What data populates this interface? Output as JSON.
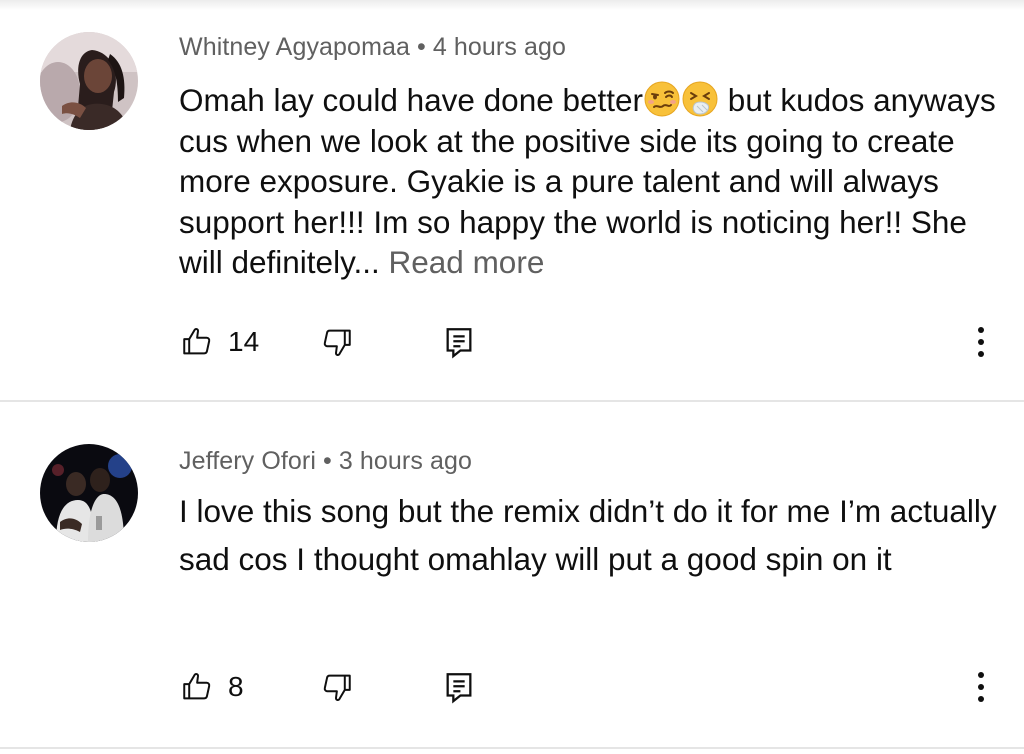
{
  "comments": [
    {
      "author": "Whitney Agyapomaa",
      "separator": "•",
      "time": "4 hours ago",
      "text_before_emoji": "Omah lay could have done better",
      "emojis": [
        "woozy-face-emoji",
        "sneezing-face-emoji"
      ],
      "text_after_emoji": " but kudos anyways cus when we look at the positive side its going to create more exposure. Gyakie is a pure talent and will always support her!!! Im so happy the world is noticing her!! She will definitely...",
      "read_more": "Read more",
      "likes": "14",
      "icons": [
        "thumbs-up-icon",
        "thumbs-down-icon",
        "reply-icon",
        "more-vert-icon"
      ]
    },
    {
      "author": "Jeffery Ofori",
      "separator": "•",
      "time": "3 hours ago",
      "text": "I love this song but the remix didn’t do it for me I’m actually sad cos I thought omahlay will put a good spin on it",
      "likes": "8",
      "icons": [
        "thumbs-up-icon",
        "thumbs-down-icon",
        "reply-icon",
        "more-vert-icon"
      ]
    }
  ],
  "colors": {
    "text_primary": "#0f0f0f",
    "text_secondary": "#606060",
    "divider": "#e5e5e5",
    "background": "#ffffff"
  }
}
